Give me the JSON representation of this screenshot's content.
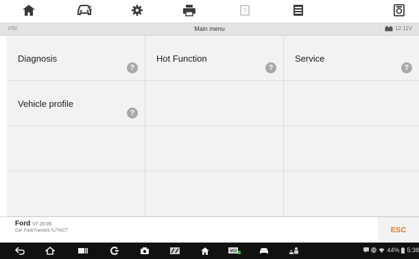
{
  "titlebar": {
    "vin_label": "VIN:",
    "title": "Main menu",
    "battery_voltage": "12.11V"
  },
  "toolbar": {
    "icons": [
      "home-icon",
      "vehicle-icon",
      "settings-icon",
      "print-icon",
      "help-icon",
      "save-icon",
      "data-logging-icon"
    ]
  },
  "menu": {
    "items": [
      {
        "label": "Diagnosis",
        "help": "?"
      },
      {
        "label": "Hot Function",
        "help": "?"
      },
      {
        "label": "Service",
        "help": "?"
      },
      {
        "label": "Vehicle profile",
        "help": "?"
      }
    ]
  },
  "footer": {
    "brand": "Ford",
    "version": "V7.20.05",
    "car_info": "Car: Ford/Transit/3.7L/TiVCT",
    "esc_label": "ESC"
  },
  "navbar": {
    "icons": [
      "back-icon",
      "launcher-icon",
      "recent-apps-icon",
      "browser-icon",
      "camera-icon",
      "vci-icon",
      "home-icon",
      "vci-status-icon",
      "car-icon",
      "service-icon"
    ],
    "status_text": "44%",
    "clock": "5:38"
  },
  "colors": {
    "accent": "#e2761f",
    "titlebar_bg": "#e3e3e3",
    "cell_bg": "#f2f2f2",
    "navbar_bg": "#111111"
  }
}
